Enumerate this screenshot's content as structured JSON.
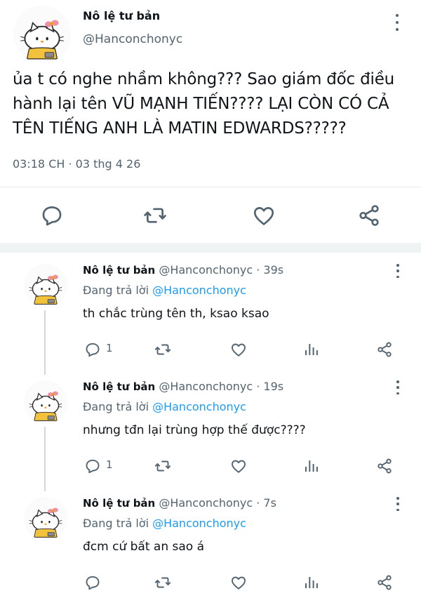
{
  "main_tweet": {
    "name": "Nô lệ tư bản",
    "handle": "@Hanconchonyc",
    "text_lines": [
      "ủa t có nghe nhầm không??? Sao giám đốc điều",
      "hành lại tên VŨ MẠNH TIẾN???? LẠI CÒN CÓ CẢ",
      "TÊN TIẾNG ANH LÀ MATIN EDWARDS?????"
    ],
    "timestamp": "03:18 CH · 03 thg 4 26"
  },
  "replies": [
    {
      "name": "Nô lệ tư bản",
      "meta": " @Hanconchonyc · 39s",
      "replying_label": "Đang trả lời ",
      "replying_to": "@Hanconchonyc",
      "text": "th chắc trùng tên th, ksao ksao",
      "reply_count": "1"
    },
    {
      "name": "Nô lệ tư bản",
      "meta": " @Hanconchonyc · 19s",
      "replying_label": "Đang trả lời ",
      "replying_to": "@Hanconchonyc",
      "text": "nhưng tđn lại trùng hợp thế được????",
      "reply_count": "1"
    },
    {
      "name": "Nô lệ tư bản",
      "meta": " @Hanconchonyc · 7s",
      "replying_label": "Đang trả lời ",
      "replying_to": "@Hanconchonyc",
      "text": "đcm cứ bất an sao á",
      "reply_count": ""
    }
  ],
  "colors": {
    "text": "#0f1419",
    "secondary": "#536471",
    "accent": "#1d9bf0",
    "divider": "#e6ecf0"
  },
  "icons": [
    "reply-icon",
    "retweet-icon",
    "like-icon",
    "views-icon",
    "share-icon",
    "more-icon"
  ]
}
